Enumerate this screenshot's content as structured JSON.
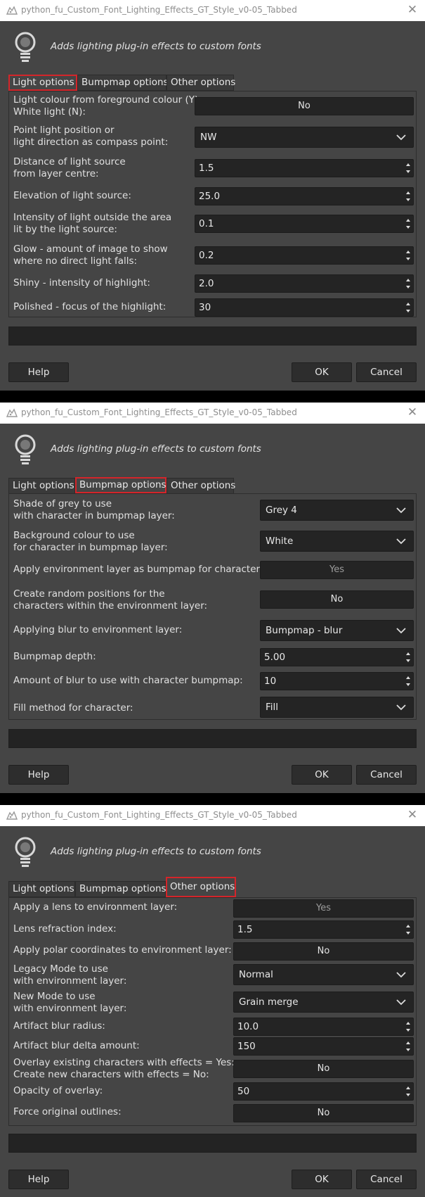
{
  "window_title": "python_fu_Custom_Font_Lighting_Effects_GT_Style_v0-05_Tabbed",
  "description": "Adds lighting plug-in effects to custom fonts",
  "tabs": [
    "Light options",
    "Bumpmap options",
    "Other options"
  ],
  "buttons": {
    "help": "Help",
    "ok": "OK",
    "cancel": "Cancel"
  },
  "icons": {
    "app": "gimp-wilber-icon",
    "bulb": "light-bulb-icon",
    "close": "close-icon",
    "combo": "chevron-down-icon",
    "spin": "spin-arrows-icon"
  },
  "colors": {
    "active_tab_outline": "#d4252a",
    "window_bg": "#454545",
    "field_bg": "#242424"
  },
  "light": {
    "light_colour_label": "Light colour from foreground colour (Y)\nWhite light (N):",
    "light_colour_value": "No",
    "light_position_label": "Point light position or\nlight direction as compass point:",
    "light_position_value": "NW",
    "distance_label": "Distance of light source\nfrom layer centre:",
    "distance_value": "1.5",
    "elevation_label": "Elevation of light source:",
    "elevation_value": "25.0",
    "intensity_label": "Intensity of light outside the area\nlit by the light source:",
    "intensity_value": "0.1",
    "glow_label": "Glow - amount of image to show\nwhere no direct light falls:",
    "glow_value": "0.2",
    "shiny_label": "Shiny - intensity of highlight:",
    "shiny_value": "2.0",
    "polished_label": "Polished - focus of the highlight:",
    "polished_value": "30"
  },
  "bump": {
    "grey_label": "Shade of grey to use\nwith character in bumpmap layer:",
    "grey_value": "Grey 4",
    "bg_label": "Background colour to use\nfor character in bumpmap layer:",
    "bg_value": "White",
    "env_label": "Apply environment layer as bumpmap for character:",
    "env_value": "Yes",
    "random_label": "Create random positions for the\ncharacters within the environment layer:",
    "random_value": "No",
    "blur_label": "Applying blur to environment layer:",
    "blur_value": "Bumpmap - blur",
    "depth_label": "Bumpmap depth:",
    "depth_value": "5.00",
    "amount_label": "Amount of blur to use with character bumpmap:",
    "amount_value": "10",
    "fill_label": "Fill method for character:",
    "fill_value": "Fill"
  },
  "other": {
    "lens_label": "Apply a lens to environment layer:",
    "lens_value": "Yes",
    "refraction_label": "Lens refraction index:",
    "refraction_value": "1.5",
    "polar_label": "Apply polar coordinates to environment layer:",
    "polar_value": "No",
    "legacy_label": "Legacy Mode to use\nwith environment layer:",
    "legacy_value": "Normal",
    "newmode_label": "New Mode to use\nwith environment layer:",
    "newmode_value": "Grain merge",
    "artifact_radius_label": "Artifact blur radius:",
    "artifact_radius_value": "10.0",
    "artifact_delta_label": "Artifact blur delta amount:",
    "artifact_delta_value": "150",
    "overlay_label": "Overlay existing characters with effects = Yes:\nCreate new characters with effects = No:",
    "overlay_value": "No",
    "opacity_label": "Opacity of overlay:",
    "opacity_value": "50",
    "outlines_label": "Force original outlines:",
    "outlines_value": "No"
  }
}
